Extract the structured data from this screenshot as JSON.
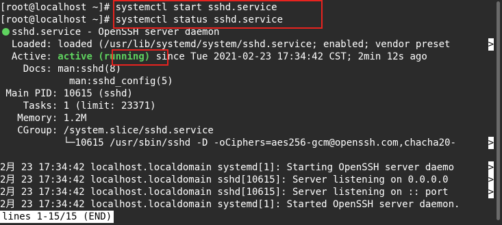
{
  "terminal": {
    "prompt": "[root@localhost ~]#",
    "cmd1": "systemctl start sshd.service",
    "cmd2": "systemctl status sshd.service",
    "unit_title": "sshd.service - OpenSSH server daemon",
    "loaded_label": "  Loaded:",
    "loaded_value": " loaded (/usr/lib/systemd/system/sshd.service; enabled; vendor preset",
    "active_label": "  Active:",
    "active_state": "active",
    "active_sub": "(running)",
    "active_since": " since Tue 2021-02-23 17:34:42 CST; 2min 12s ago",
    "docs_label": "    Docs:",
    "docs1": " man:sshd(8)",
    "docs2": "man:sshd_config(5)",
    "mainpid_line": " Main PID: 10615 (sshd)",
    "tasks_line": "    Tasks: 1 (limit: 23371)",
    "memory_line": "   Memory: 1.2M",
    "cgroup_line": "   CGroup: /system.slice/sshd.service",
    "cgroup_child": "           └─10615 /usr/sbin/sshd -D -oCiphers=aes256-gcm@openssh.com,chacha20-",
    "logs": [
      "2月 23 17:34:42 localhost.localdomain systemd[1]: Starting OpenSSH server daemo",
      "2月 23 17:34:42 localhost.localdomain sshd[10615]: Server listening on 0.0.0.0",
      "2月 23 17:34:42 localhost.localdomain sshd[10615]: Server listening on :: port",
      "2月 23 17:34:42 localhost.localdomain systemd[1]: Started OpenSSH server daemon."
    ],
    "trunc_marker": ">",
    "pager_status": "lines 1-15/15 (END)"
  }
}
